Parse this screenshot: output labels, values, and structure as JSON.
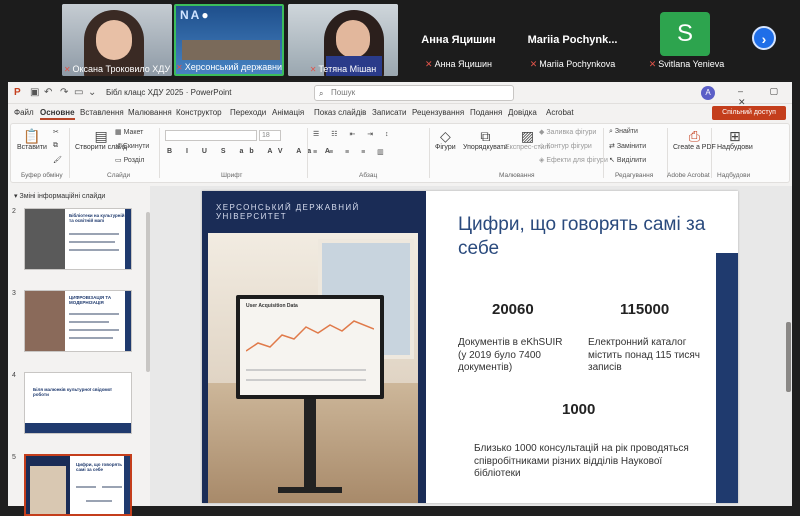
{
  "meeting": {
    "participants": [
      {
        "name": "Оксана Троковило ХДУ",
        "kind": "video"
      },
      {
        "name": "Херсонський державни...",
        "kind": "video"
      },
      {
        "name": "Тетяна Мішан",
        "kind": "video"
      },
      {
        "name": "Анна Яцишин",
        "kind": "name"
      },
      {
        "name": "Mariia Pochynkova",
        "display": "Mariia Pochynk...",
        "kind": "name"
      },
      {
        "name": "Svitlana Yenieva",
        "initial": "S",
        "kind": "avatar"
      }
    ],
    "next_label": "›",
    "avatar_color": "#2da44e",
    "mic_muted_icon": "mic-muted-icon"
  },
  "ppt": {
    "doc_title": "Бібл клацс ХДУ 2025 · PowerPoint",
    "search_placeholder": "Пошук",
    "user_initial": "А",
    "menu": [
      "Файл",
      "Основне",
      "Вставлення",
      "Малювання",
      "Конструктор",
      "Переходи",
      "Анімація",
      "Показ слайдів",
      "Записати",
      "Рецензування",
      "Подання",
      "Довідка",
      "Acrobat"
    ],
    "active_menu": "Основне",
    "share_label": "Спільний доступ",
    "ribbon": {
      "paste": "Вставити",
      "new_slide": "Створити слайд",
      "layout": "Макет",
      "reset": "Скинути",
      "section": "Розділ",
      "font_size": "18",
      "shapes": "Фігури",
      "arrange": "Упорядкувати",
      "quick_styles": "Експрес-стилі",
      "shape_fill": "Заливка фігури",
      "shape_outline": "Контур фігури",
      "shape_effects": "Ефекти для фігури",
      "find": "Знайти",
      "replace": "Замінити",
      "select": "Виділити",
      "create_pdf": "Create a PDF",
      "addins": "Надбудови",
      "groups": [
        "Буфер обміну",
        "Слайди",
        "Шрифт",
        "Абзац",
        "Малювання",
        "Редагування",
        "Adobe Acrobat",
        "Надбудови"
      ]
    },
    "thumbs": {
      "section_title": "Зміні інформаційні слайди",
      "slides": [
        {
          "num": "2",
          "title": "Бібліотеки на культурній та освітній мапі"
        },
        {
          "num": "3",
          "title": "ЦИФРОВІЗАЦІЯ ТА МОДЕРНІЗАЦІЯ"
        },
        {
          "num": "4",
          "title": "Біля малюнків культурної свідомої роботи"
        },
        {
          "num": "5",
          "title": "Цифри, що говорять самі за себе"
        }
      ],
      "selected": "5"
    },
    "slide": {
      "university": "ХЕРСОНСЬКИЙ ДЕРЖАВНИЙ УНІВЕРСИТЕТ",
      "headline": "Цифри, що говорять самі за себе",
      "screen_title": "User Acquisition Data",
      "stats": [
        {
          "value": "20060",
          "text": "Документів в eKhSUIR (у 2019 було 7400 документів)"
        },
        {
          "value": "115000",
          "text": "Електронний каталог містить понад 115 тисяч записів"
        },
        {
          "value": "1000",
          "text": "Близько 1000 консультацій на рік проводяться співробітниками різних відділів Наукової бібліотеки"
        }
      ]
    }
  }
}
